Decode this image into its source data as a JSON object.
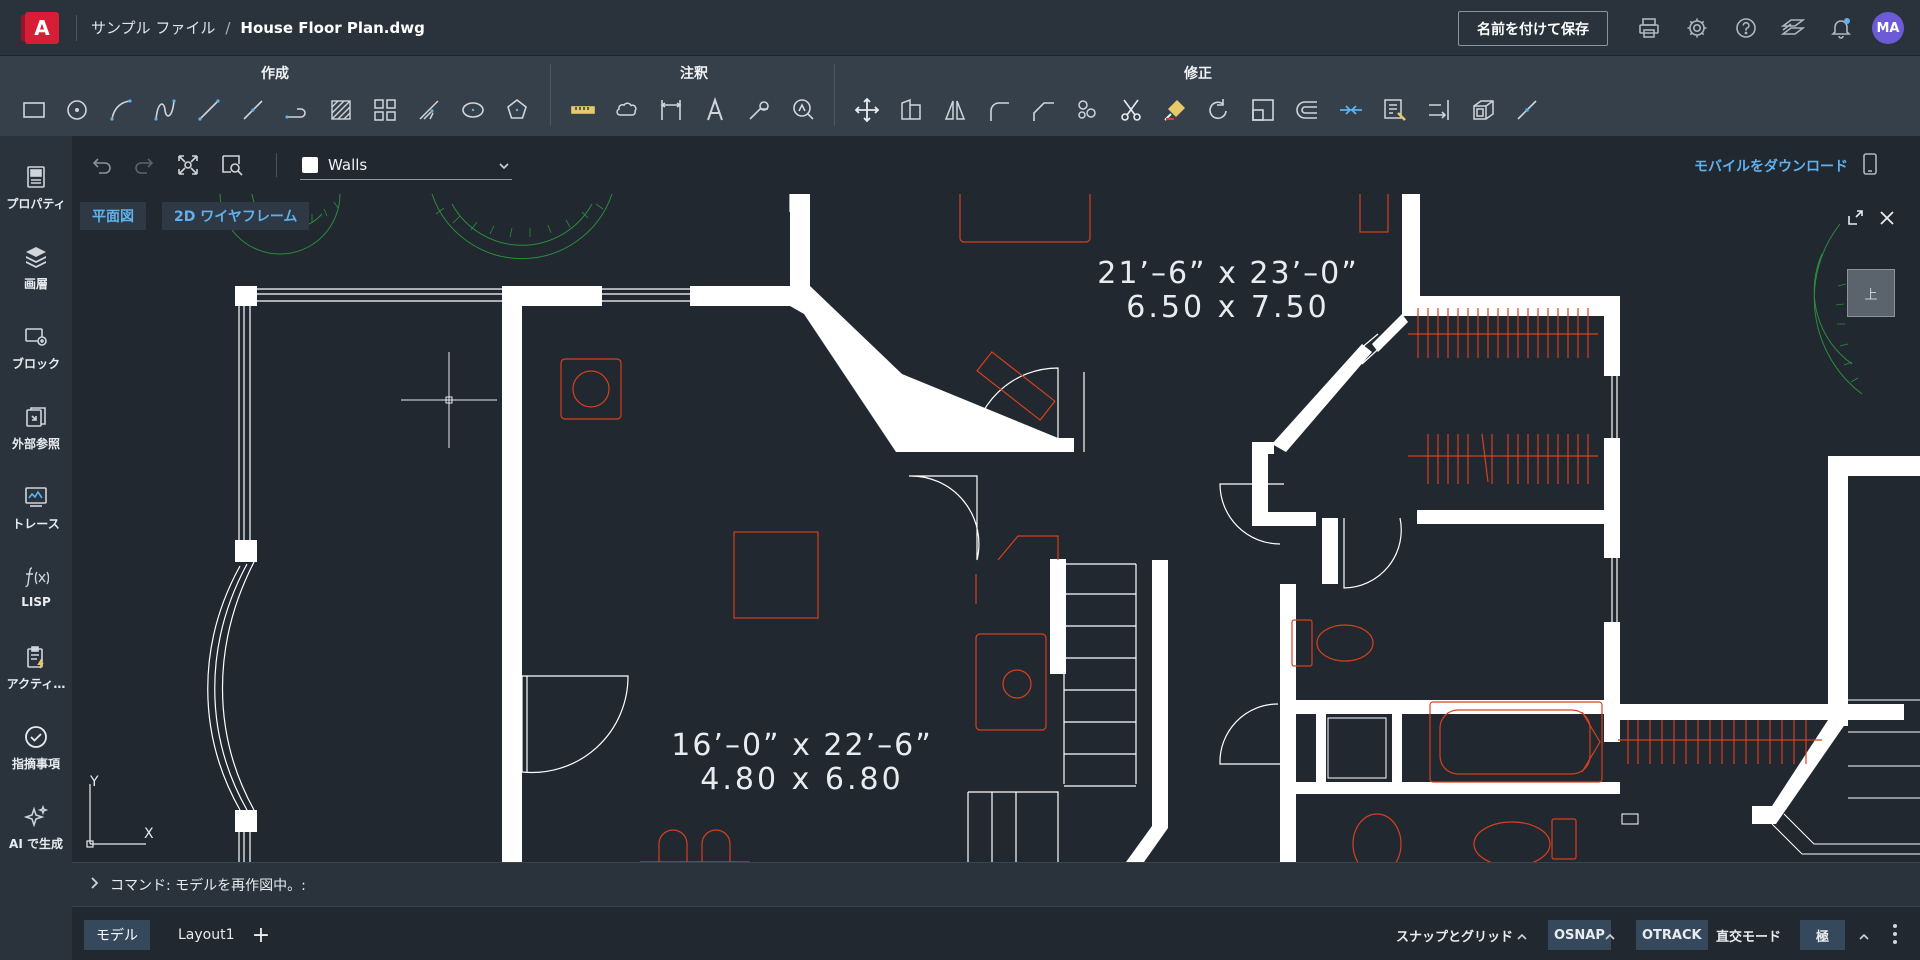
{
  "header": {
    "logo_letter": "A",
    "folder": "サンプル ファイル",
    "separator": "/",
    "file_name": "House Floor Plan.dwg",
    "save_button": "名前を付けて保存",
    "icons": [
      "printer-icon",
      "gear-icon",
      "help-icon",
      "drawings-icon",
      "bell-icon"
    ],
    "avatar_initials": "MA",
    "notification_color": "#5fb1ee"
  },
  "ribbon": {
    "groups": [
      {
        "title": "作成",
        "tools": [
          "rectangle-icon",
          "circle-icon",
          "arc-icon",
          "spline-icon",
          "line-icon",
          "polyline-icon",
          "polyline-arc-icon",
          "hatch-icon",
          "array-icon",
          "trim-icon",
          "ellipse-icon",
          "polygon-icon"
        ]
      },
      {
        "title": "注釈",
        "tools": [
          "measure-icon",
          "revision-cloud-icon",
          "dimension-icon",
          "text-icon",
          "leader-icon",
          "zoom-icon"
        ]
      },
      {
        "title": "修正",
        "tools": [
          "move-icon",
          "copy-icon",
          "mirror-icon",
          "fillet-icon",
          "chamfer-icon",
          "group-icon",
          "cut-icon",
          "match-properties-icon",
          "rotate-icon",
          "scale-icon",
          "offset-icon",
          "join-icon",
          "block-editor-icon",
          "extend-icon",
          "3d-box-icon",
          "explode-icon"
        ]
      }
    ]
  },
  "leftbar": {
    "items": [
      {
        "label": "プロパティ",
        "icon": "properties-icon"
      },
      {
        "label": "画層",
        "icon": "layers-icon"
      },
      {
        "label": "ブロック",
        "icon": "block-icon"
      },
      {
        "label": "外部参照",
        "icon": "xref-icon"
      },
      {
        "label": "トレース",
        "icon": "trace-icon"
      },
      {
        "label": "LISP",
        "icon": "lisp-icon"
      },
      {
        "label": "アクティ…",
        "icon": "activity-icon"
      },
      {
        "label": "指摘事項",
        "icon": "issues-icon"
      },
      {
        "label": "AI で生成",
        "icon": "ai-sparkle-icon"
      }
    ]
  },
  "toolrow": {
    "layer_name": "Walls",
    "mobile_link": "モバイルをダウンロード"
  },
  "canvas": {
    "view_tab_1": "平面図",
    "view_tab_2": "2D ワイヤフレーム",
    "view_cube_label": "上",
    "room1_size_imperial": "16’–0” x 22’–6”",
    "room1_size_metric": "4.80 x 6.80",
    "room2_size_imperial": "21’–6” x 23’–0”",
    "room2_size_metric": "6.50 x 7.50",
    "ucs_y": "Y",
    "ucs_x": "X",
    "wall_color": "#ffffff",
    "furniture_color": "#d7401e",
    "landscape_color": "#2e8b3e"
  },
  "command": {
    "text": "コマンド: モデルを再作図中。:"
  },
  "statusbar": {
    "tab_model": "モデル",
    "tab_layout": "Layout1",
    "snap_grid": "スナップとグリッド",
    "osnap": "OSNAP",
    "otrack": "OTRACK",
    "ortho": "直交モード",
    "polar": "極"
  }
}
